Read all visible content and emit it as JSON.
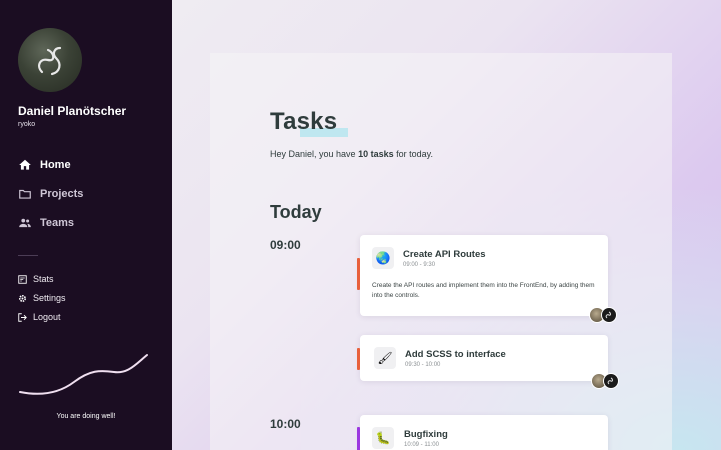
{
  "sidebar": {
    "user_name": "Daniel Planötscher",
    "user_handle": "ryoko",
    "nav": [
      {
        "label": "Home",
        "icon": "home-icon",
        "active": true
      },
      {
        "label": "Projects",
        "icon": "folder-icon",
        "active": false
      },
      {
        "label": "Teams",
        "icon": "people-icon",
        "active": false
      }
    ],
    "secondary": [
      {
        "label": "Stats",
        "icon": "stats-icon"
      },
      {
        "label": "Settings",
        "icon": "gear-icon"
      },
      {
        "label": "Logout",
        "icon": "logout-icon"
      }
    ],
    "status_text": "You are doing well!"
  },
  "main": {
    "title": "Tasks",
    "greeting_prefix": "Hey Daniel, you have ",
    "greeting_count": "10 tasks",
    "greeting_suffix": " for today.",
    "section": "Today",
    "times": [
      "09:00",
      "10:00"
    ],
    "tasks": [
      {
        "title": "Create API Routes",
        "time": "09:00 - 9:30",
        "description": "Create the API routes and implement them into the FrontEnd, by adding them into the controls.",
        "icon": "globe-icon",
        "glyph": "🌏",
        "accent": "#e8603c"
      },
      {
        "title": "Add SCSS to interface",
        "time": "09:30 - 10:00",
        "description": "",
        "icon": "brush-icon",
        "glyph": "🖌",
        "accent": "#e8603c"
      },
      {
        "title": "Bugfixing",
        "time": "10:09 - 11:00",
        "description": "",
        "icon": "bug-icon",
        "glyph": "🐛",
        "accent": "#9b38e0"
      }
    ]
  },
  "colors": {
    "sidebar_bg": "#1b0d22",
    "text_dark": "#2f3c3c",
    "title_highlight": "#b6e5ef",
    "accent_orange": "#e8603c",
    "accent_purple": "#9b38e0"
  }
}
